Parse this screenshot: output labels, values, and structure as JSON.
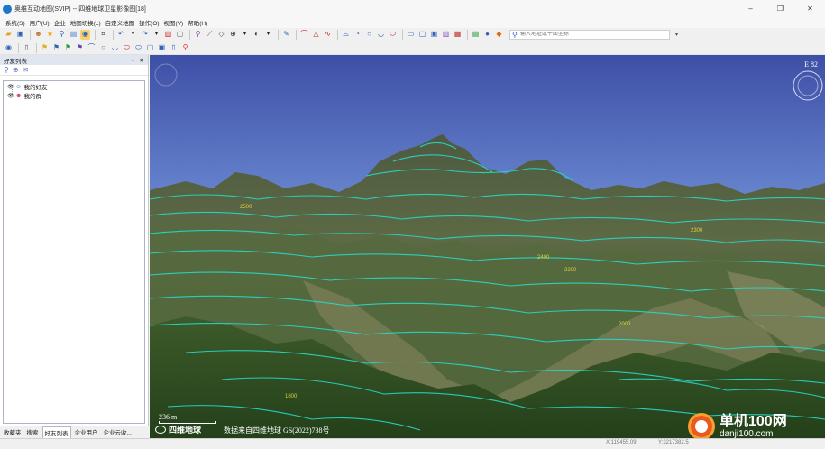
{
  "window": {
    "app_name": "奥维互动地图(SVIP)",
    "separator": "--",
    "document": "四维地球卫星影像图[18]",
    "controls": [
      "‒",
      "❐",
      "✕"
    ]
  },
  "menu": [
    "系统(S)",
    "用户(U)",
    "企业",
    "地图切换(L)",
    "自定义地图",
    "操作(O)",
    "视图(V)",
    "帮助(H)"
  ],
  "search": {
    "placeholder": "输入地址或平面坐标"
  },
  "panel": {
    "title": "好友列表",
    "pin": "▫",
    "close": "✕",
    "tree": [
      {
        "label": "我的好友"
      },
      {
        "label": "我的群"
      }
    ],
    "tabs": [
      "收藏夹",
      "搜索",
      "好友列表",
      "企业用户",
      "企业云收..."
    ],
    "active_tab": 2
  },
  "map": {
    "compass_label": "E 82",
    "scale": "236 m",
    "brand": "四维地球",
    "credit": "数据来自四维地球 GS(2022)738号"
  },
  "watermark": {
    "title": "单机100网",
    "url": "danji100.com"
  },
  "status": {
    "x": "X:119455.09",
    "y": "Y:3217382.5"
  },
  "colors": {
    "contour": "#27d9c9",
    "sky_top": "#3e4fa6",
    "sky_bottom": "#9bbbe8"
  }
}
